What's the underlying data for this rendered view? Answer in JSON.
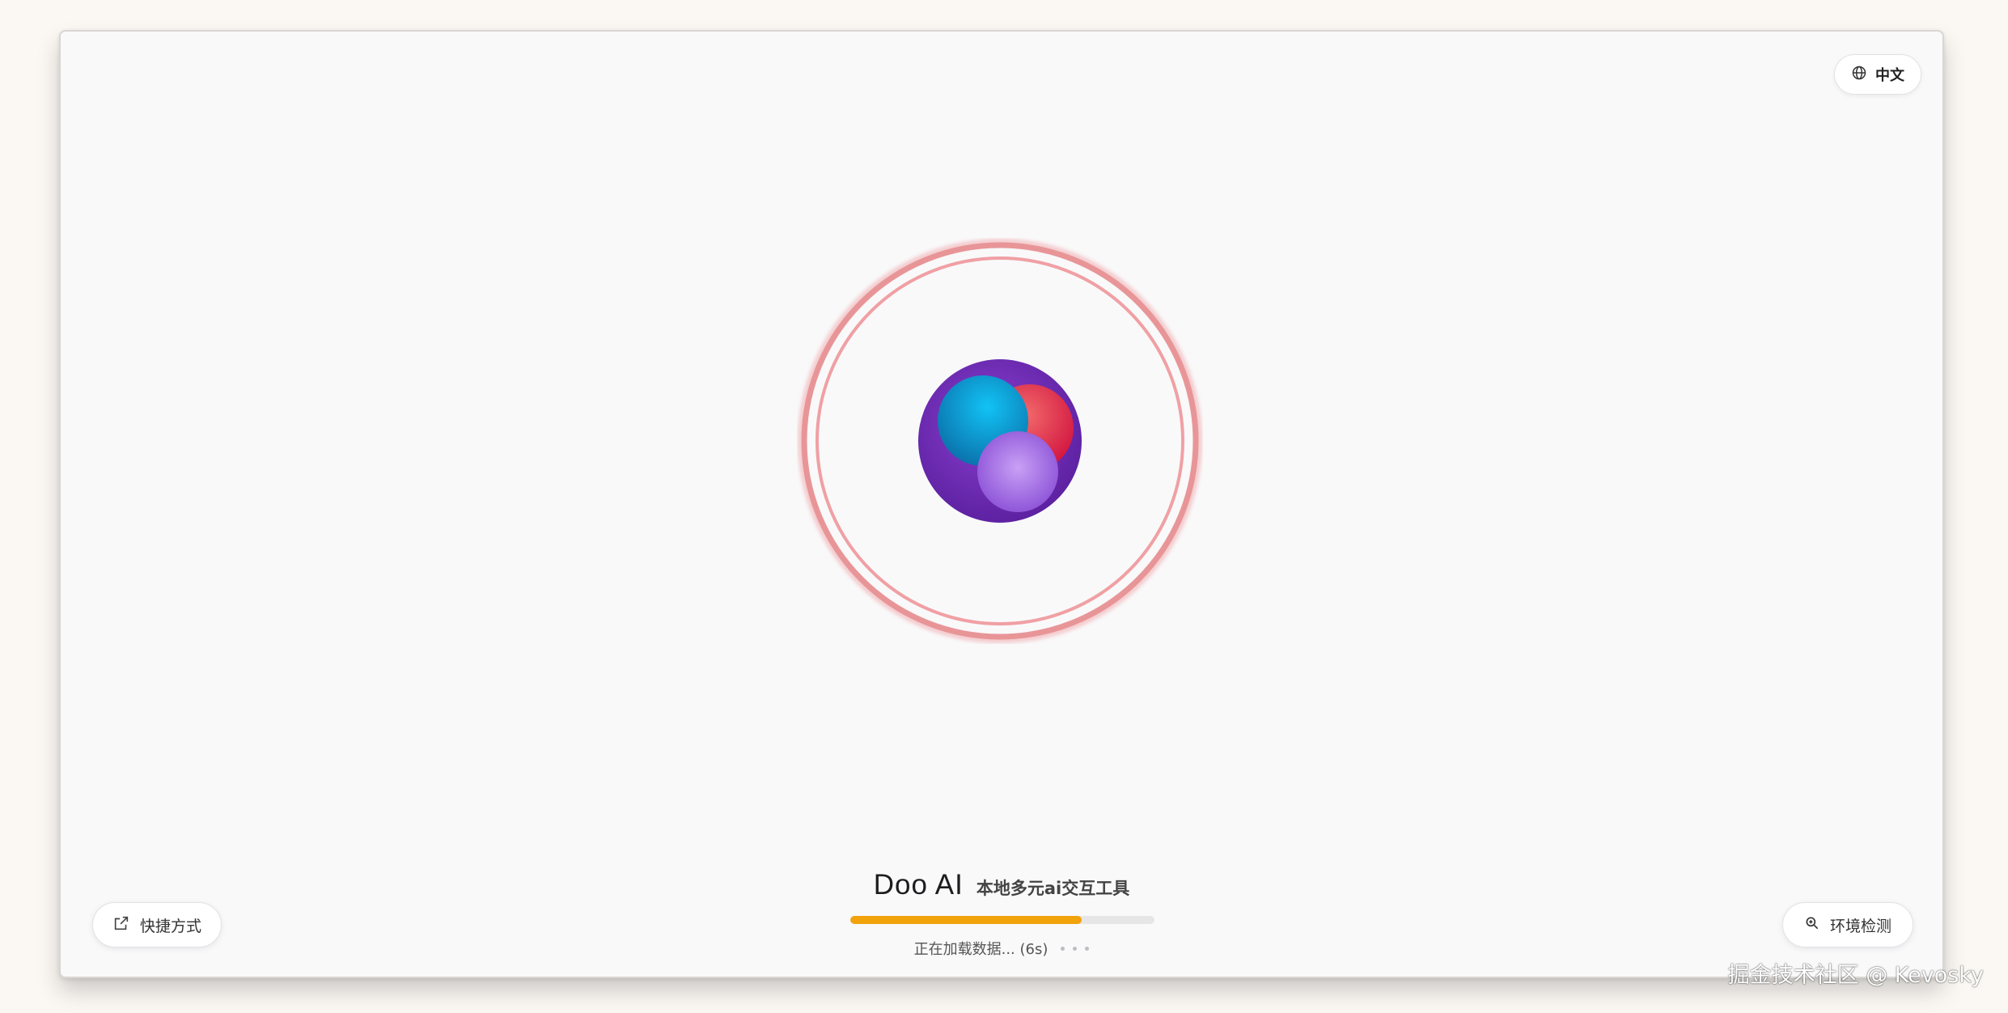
{
  "language_toggle": {
    "label": "中文",
    "icon": "globe-icon"
  },
  "shortcut_button": {
    "label": "快捷方式",
    "icon": "external-link-icon"
  },
  "env_check_button": {
    "label": "环境检测",
    "icon": "search-zoom-icon"
  },
  "app": {
    "name": "Doo AI",
    "subtitle": "本地多元ai交互工具"
  },
  "loading": {
    "status_text": "正在加载数据... (6s)",
    "progress": 0.76,
    "colors": {
      "fill": "#f2a20b",
      "track": "#e6e6e6"
    }
  },
  "watermark": {
    "text": "掘金技术社区 @ Kevosky"
  },
  "colors": {
    "ring": "#f0a0a4",
    "orb_outer": "#6b2bb5",
    "orb_blue": "#10a8e0",
    "orb_red": "#e0204a",
    "orb_purple": "#a46ee6"
  }
}
